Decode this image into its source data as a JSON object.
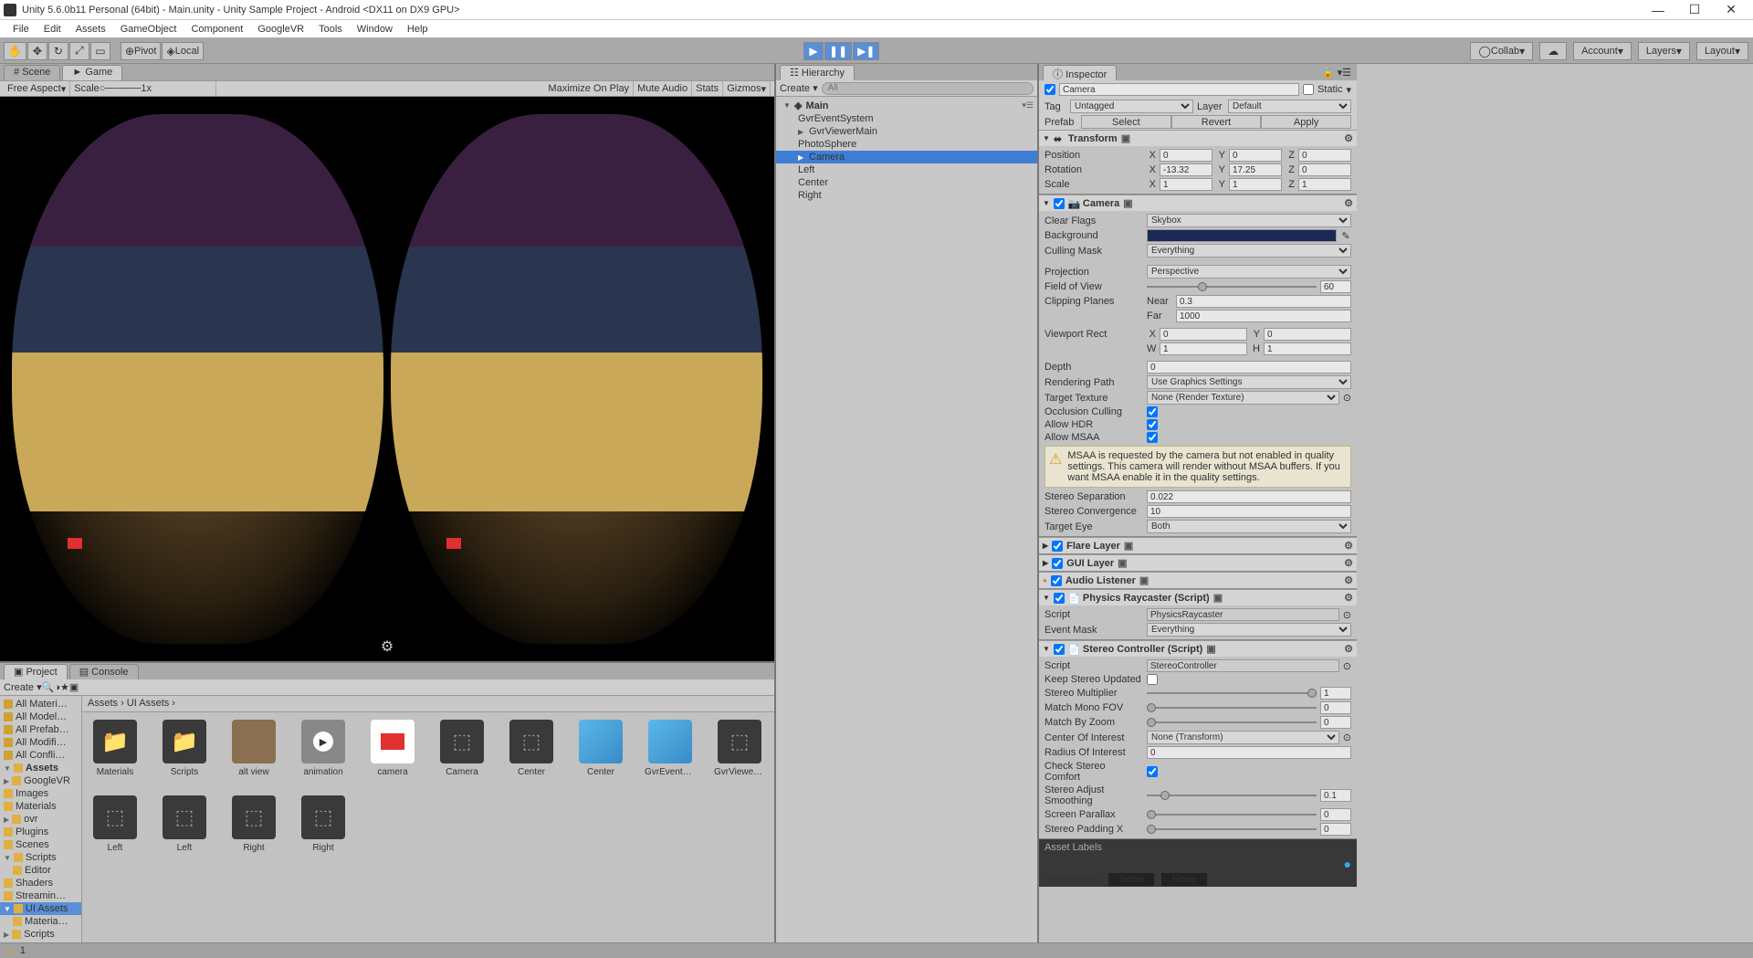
{
  "title": "Unity 5.6.0b11 Personal (64bit) - Main.unity - Unity Sample Project - Android <DX11 on DX9 GPU>",
  "menu": [
    "File",
    "Edit",
    "Assets",
    "GameObject",
    "Component",
    "GoogleVR",
    "Tools",
    "Window",
    "Help"
  ],
  "toolbar": {
    "pivot": "Pivot",
    "local": "Local",
    "collab": "Collab",
    "account": "Account",
    "layers": "Layers",
    "layout": "Layout"
  },
  "sceneTab": "Scene",
  "gameTab": "Game",
  "gameTools": {
    "aspect": "Free Aspect",
    "scale": "Scale",
    "scaleVal": "1x",
    "maxOnPlay": "Maximize On Play",
    "mute": "Mute Audio",
    "stats": "Stats",
    "gizmos": "Gizmos"
  },
  "projectTab": "Project",
  "consoleTab": "Console",
  "projTools": {
    "create": "Create"
  },
  "projTree": {
    "fav": [
      "All Materi…",
      "All Model…",
      "All Prefab…",
      "All Modifi…",
      "All Confli…"
    ],
    "assetsLabel": "Assets",
    "assets": [
      "GoogleVR",
      "Images",
      "Materials",
      "ovr",
      "Plugins",
      "Scenes",
      "Scripts",
      "Shaders",
      "Streamin…",
      "UI Assets",
      "Scripts"
    ],
    "assetsSub": {
      "Scripts": [
        "Editor"
      ],
      "UI Assets": [
        "Materia…"
      ]
    }
  },
  "crumb": "Assets  ›  UI Assets  ›",
  "assets": [
    {
      "name": "Materials",
      "type": "folder"
    },
    {
      "name": "Scripts",
      "type": "folder"
    },
    {
      "name": "alt view",
      "type": "alt"
    },
    {
      "name": "animation",
      "type": "play"
    },
    {
      "name": "camera",
      "type": "cam"
    },
    {
      "name": "Camera",
      "type": "prefab"
    },
    {
      "name": "Center",
      "type": "prefab"
    },
    {
      "name": "Center",
      "type": "cube"
    },
    {
      "name": "GvrEventS…",
      "type": "cube"
    },
    {
      "name": "GvrViewer…",
      "type": "prefab"
    },
    {
      "name": "Left",
      "type": "prefab"
    },
    {
      "name": "Left",
      "type": "prefab"
    },
    {
      "name": "Right",
      "type": "prefab"
    },
    {
      "name": "Right",
      "type": "prefab"
    }
  ],
  "hier": {
    "title": "Hierarchy",
    "create": "Create",
    "searchPH": "All",
    "main": "Main",
    "items": [
      "GvrEventSystem",
      "GvrViewerMain",
      "PhotoSphere",
      "Camera",
      "Left",
      "Center",
      "Right"
    ]
  },
  "insp": {
    "title": "Inspector",
    "name": "Camera",
    "static": "Static",
    "tagLbl": "Tag",
    "tag": "Untagged",
    "layerLbl": "Layer",
    "layer": "Default",
    "prefabLbl": "Prefab",
    "prefabBtns": [
      "Select",
      "Revert",
      "Apply"
    ],
    "transform": {
      "title": "Transform",
      "posLbl": "Position",
      "pos": [
        "0",
        "0",
        "0"
      ],
      "rotLbl": "Rotation",
      "rot": [
        "-13.32",
        "17.25",
        "0"
      ],
      "scaleLbl": "Scale",
      "scale": [
        "1",
        "1",
        "1"
      ]
    },
    "camera": {
      "title": "Camera",
      "clearFlagsLbl": "Clear Flags",
      "clearFlags": "Skybox",
      "backgroundLbl": "Background",
      "cullingLbl": "Culling Mask",
      "culling": "Everything",
      "projLbl": "Projection",
      "proj": "Perspective",
      "fovLbl": "Field of View",
      "fov": "60",
      "clipLbl": "Clipping Planes",
      "near": "Near",
      "nearV": "0.3",
      "far": "Far",
      "farV": "1000",
      "viewRectLbl": "Viewport Rect",
      "vx": "0",
      "vy": "0",
      "vw": "1",
      "vh": "1",
      "depthLbl": "Depth",
      "depth": "0",
      "renderPathLbl": "Rendering Path",
      "renderPath": "Use Graphics Settings",
      "targetTexLbl": "Target Texture",
      "targetTex": "None (Render Texture)",
      "occLbl": "Occlusion Culling",
      "hdrLbl": "Allow HDR",
      "msaaLbl": "Allow MSAA",
      "warn": "MSAA is requested by the camera but not enabled in quality settings. This camera will render without MSAA buffers. If you want MSAA enable it in the quality settings.",
      "sepLbl": "Stereo Separation",
      "sep": "0.022",
      "convLbl": "Stereo Convergence",
      "conv": "10",
      "teyeLbl": "Target Eye",
      "teye": "Both"
    },
    "flare": "Flare Layer",
    "gui": "GUI Layer",
    "audio": "Audio Listener",
    "physray": {
      "title": "Physics Raycaster (Script)",
      "scriptLbl": "Script",
      "script": "PhysicsRaycaster",
      "maskLbl": "Event Mask",
      "mask": "Everything"
    },
    "stereo": {
      "title": "Stereo Controller (Script)",
      "scriptLbl": "Script",
      "script": "StereoController",
      "keepLbl": "Keep Stereo Updated",
      "multLbl": "Stereo Multiplier",
      "mult": "1",
      "monoLbl": "Match Mono FOV",
      "mono": "0",
      "zoomLbl": "Match By Zoom",
      "zoom": "0",
      "coiLbl": "Center Of Interest",
      "coi": "None (Transform)",
      "roiLbl": "Radius Of Interest",
      "roi": "0",
      "chkLbl": "Check Stereo Comfort",
      "sasLbl": "Stereo Adjust Smoothing",
      "sas": "0.1",
      "parLbl": "Screen Parallax",
      "par": "0",
      "padLbl": "Stereo Padding X",
      "pad": "0"
    },
    "assetLabels": "Asset Labels",
    "assetBundle": "AssetBundle",
    "none": "None"
  },
  "status": "1"
}
